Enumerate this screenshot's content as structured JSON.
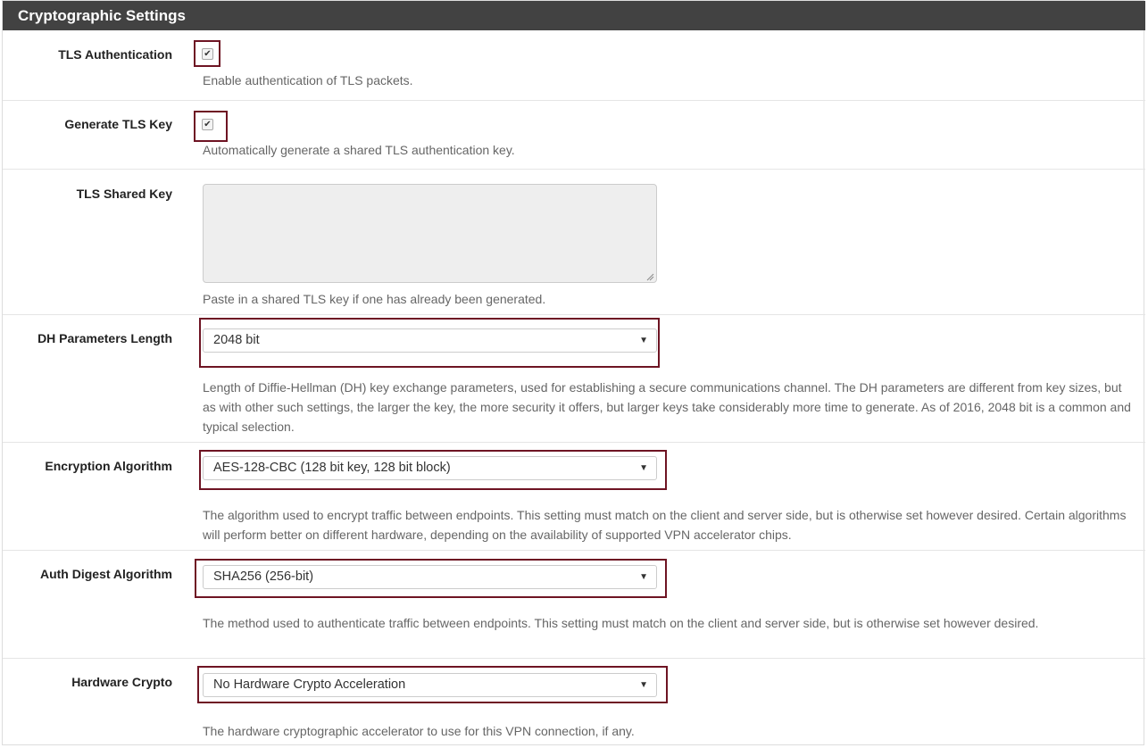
{
  "panel": {
    "title": "Cryptographic Settings"
  },
  "fields": {
    "tls_auth": {
      "label": "TLS Authentication",
      "checked": true,
      "help": "Enable authentication of TLS packets."
    },
    "gen_tls_key": {
      "label": "Generate TLS Key",
      "checked": true,
      "help": "Automatically generate a shared TLS authentication key."
    },
    "tls_shared_key": {
      "label": "TLS Shared Key",
      "value": "",
      "help": "Paste in a shared TLS key if one has already been generated."
    },
    "dh_length": {
      "label": "DH Parameters Length",
      "value": "2048 bit",
      "help": "Length of Diffie-Hellman (DH) key exchange parameters, used for establishing a secure communications channel. The DH parameters are different from key sizes, but as with other such settings, the larger the key, the more security it offers, but larger keys take considerably more time to generate. As of 2016, 2048 bit is a common and typical selection."
    },
    "encryption": {
      "label": "Encryption Algorithm",
      "value": "AES-128-CBC (128 bit key, 128 bit block)",
      "help": "The algorithm used to encrypt traffic between endpoints. This setting must match on the client and server side, but is otherwise set however desired. Certain algorithms will perform better on different hardware, depending on the availability of supported VPN accelerator chips."
    },
    "auth_digest": {
      "label": "Auth Digest Algorithm",
      "value": "SHA256 (256-bit)",
      "help": "The method used to authenticate traffic between endpoints. This setting must match on the client and server side, but is otherwise set however desired."
    },
    "hw_crypto": {
      "label": "Hardware Crypto",
      "value": "No Hardware Crypto Acceleration",
      "help": "The hardware cryptographic accelerator to use for this VPN connection, if any."
    }
  },
  "icons": {
    "check": "check-icon",
    "caret": "caret-down-icon",
    "resize": "resize-grip-icon"
  },
  "colors": {
    "header_bg": "#424242",
    "highlight_border": "#6e1423",
    "help_text": "#666666"
  }
}
